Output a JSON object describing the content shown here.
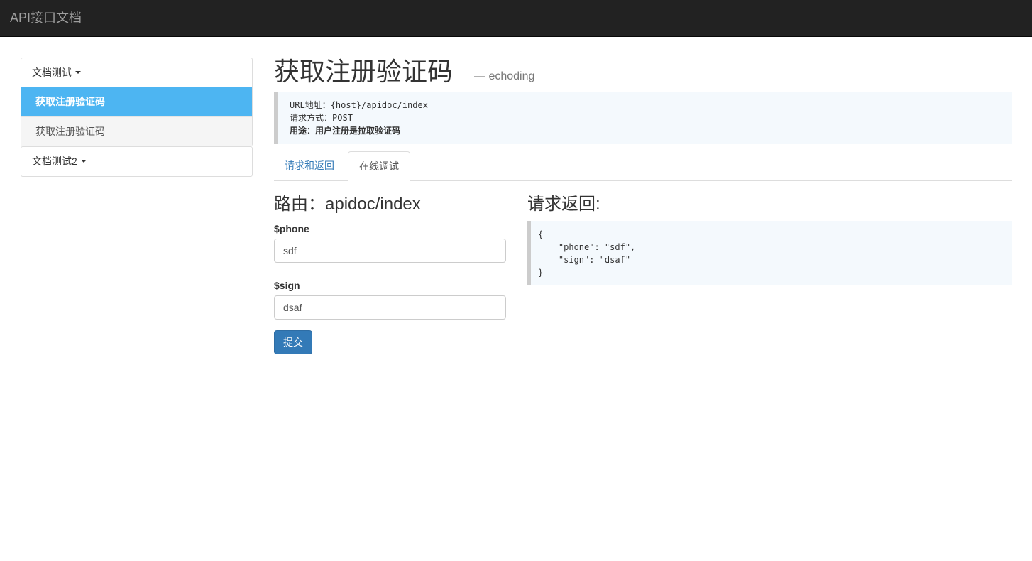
{
  "navbar": {
    "brand": "API接口文档"
  },
  "sidebar": {
    "groups": [
      {
        "label": "文档测试",
        "items": [
          {
            "label": "获取注册验证码",
            "active": true
          },
          {
            "label": "获取注册验证码",
            "active": false
          }
        ]
      },
      {
        "label": "文档测试2",
        "items": []
      }
    ]
  },
  "main": {
    "title": "获取注册验证码",
    "author": "— echoding",
    "info": {
      "url_label": "URL地址：",
      "url_value": "{host}/apidoc/index",
      "method_label": "请求方式：",
      "method_value": "POST",
      "purpose": "用途：用户注册是拉取验证码"
    },
    "tabs": [
      {
        "label": "请求和返回",
        "active": false
      },
      {
        "label": "在线调试",
        "active": true
      }
    ],
    "route_title": "路由：apidoc/index",
    "fields": [
      {
        "label": "$phone",
        "value": "sdf"
      },
      {
        "label": "$sign",
        "value": "dsaf"
      }
    ],
    "submit_label": "提交",
    "response_title": "请求返回:",
    "response_body": "{\n    \"phone\": \"sdf\",\n    \"sign\": \"dsaf\"\n}"
  },
  "colors": {
    "navbar_bg": "#222222",
    "active_item": "#4db5f2",
    "primary_button": "#337ab7",
    "code_bg": "#f4f9fd"
  }
}
